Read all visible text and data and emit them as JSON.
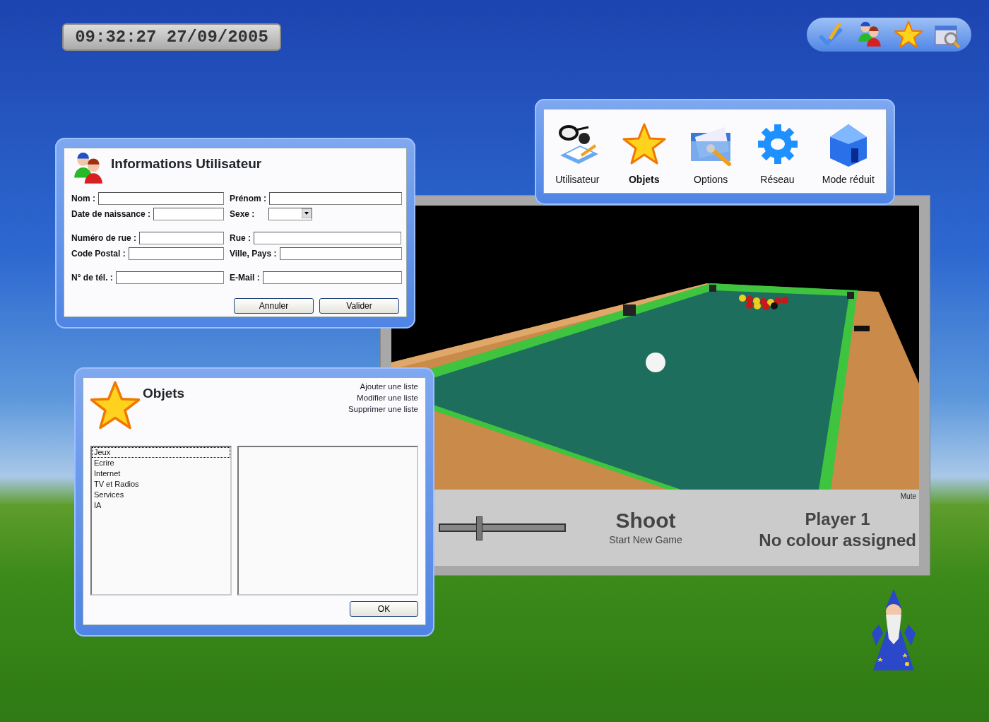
{
  "clock": {
    "text": "09:32:27 27/09/2005"
  },
  "launcher": {
    "items": [
      {
        "label": "Utilisateur",
        "selected": false
      },
      {
        "label": "Objets",
        "selected": true
      },
      {
        "label": "Options",
        "selected": false
      },
      {
        "label": "Réseau",
        "selected": false
      },
      {
        "label": "Mode réduit",
        "selected": false
      }
    ]
  },
  "game": {
    "mute": "Mute",
    "action": "Shoot",
    "new_game": "Start New Game",
    "player": "Player 1",
    "colour": "No colour assigned",
    "power": {
      "level": 0.32
    }
  },
  "user_info": {
    "title": "Informations Utilisateur",
    "groups": [
      [
        [
          {
            "label": "Nom :",
            "kind": "text"
          },
          {
            "label": "Prénom :",
            "kind": "text"
          }
        ],
        [
          {
            "label": "Date de naissance :",
            "kind": "text"
          },
          {
            "label": "Sexe :",
            "kind": "select"
          }
        ]
      ],
      [
        [
          {
            "label": "Numéro de rue :",
            "kind": "text"
          },
          {
            "label": "Rue :",
            "kind": "text"
          }
        ],
        [
          {
            "label": "Code Postal :",
            "kind": "text"
          },
          {
            "label": "Ville, Pays :",
            "kind": "text"
          }
        ]
      ],
      [
        [
          {
            "label": "N° de tél. :",
            "kind": "text"
          },
          {
            "label": "E-Mail :",
            "kind": "text"
          }
        ]
      ]
    ],
    "buttons": [
      "Annuler",
      "Valider"
    ]
  },
  "objets": {
    "title": "Objets",
    "links": [
      "Ajouter une liste",
      "Modifier une liste",
      "Supprimer une liste"
    ],
    "list": [
      {
        "label": "Jeux",
        "selected": true
      },
      {
        "label": "Ecrire",
        "selected": false
      },
      {
        "label": "Internet",
        "selected": false
      },
      {
        "label": "TV et Radios",
        "selected": false
      },
      {
        "label": "Services",
        "selected": false
      },
      {
        "label": "IA",
        "selected": false
      }
    ],
    "button": "OK"
  }
}
